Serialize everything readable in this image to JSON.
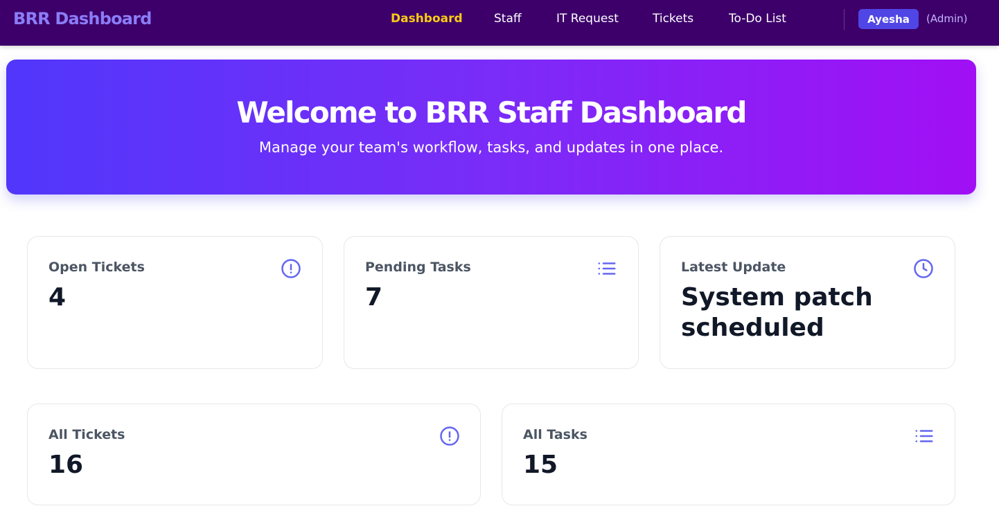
{
  "nav": {
    "brand": "BRR Dashboard",
    "links": [
      {
        "label": "Dashboard",
        "active": true
      },
      {
        "label": "Staff",
        "active": false
      },
      {
        "label": "IT Request",
        "active": false
      },
      {
        "label": "Tickets",
        "active": false
      },
      {
        "label": "To-Do List",
        "active": false
      }
    ],
    "user": {
      "name": "Ayesha",
      "role": "(Admin)"
    }
  },
  "hero": {
    "title": "Welcome to BRR Staff Dashboard",
    "subtitle": "Manage your team's workflow, tasks, and updates in one place."
  },
  "cards": [
    {
      "label": "Open Tickets",
      "value": "4",
      "icon": "alert-circle-icon"
    },
    {
      "label": "Pending Tasks",
      "value": "7",
      "icon": "list-icon"
    },
    {
      "label": "Latest Update",
      "value": "System patch scheduled",
      "icon": "clock-icon"
    },
    {
      "label": "All Tickets",
      "value": "16",
      "icon": "alert-circle-icon"
    },
    {
      "label": "All Tasks",
      "value": "15",
      "icon": "list-icon"
    }
  ],
  "colors": {
    "nav_bg": "#3d006b",
    "brand": "#8b7df7",
    "active_link": "#facc15",
    "accent": "#4f46e5",
    "icon": "#6366f1",
    "hero_gradient": [
      "#5137fb",
      "#a10ff5"
    ]
  }
}
